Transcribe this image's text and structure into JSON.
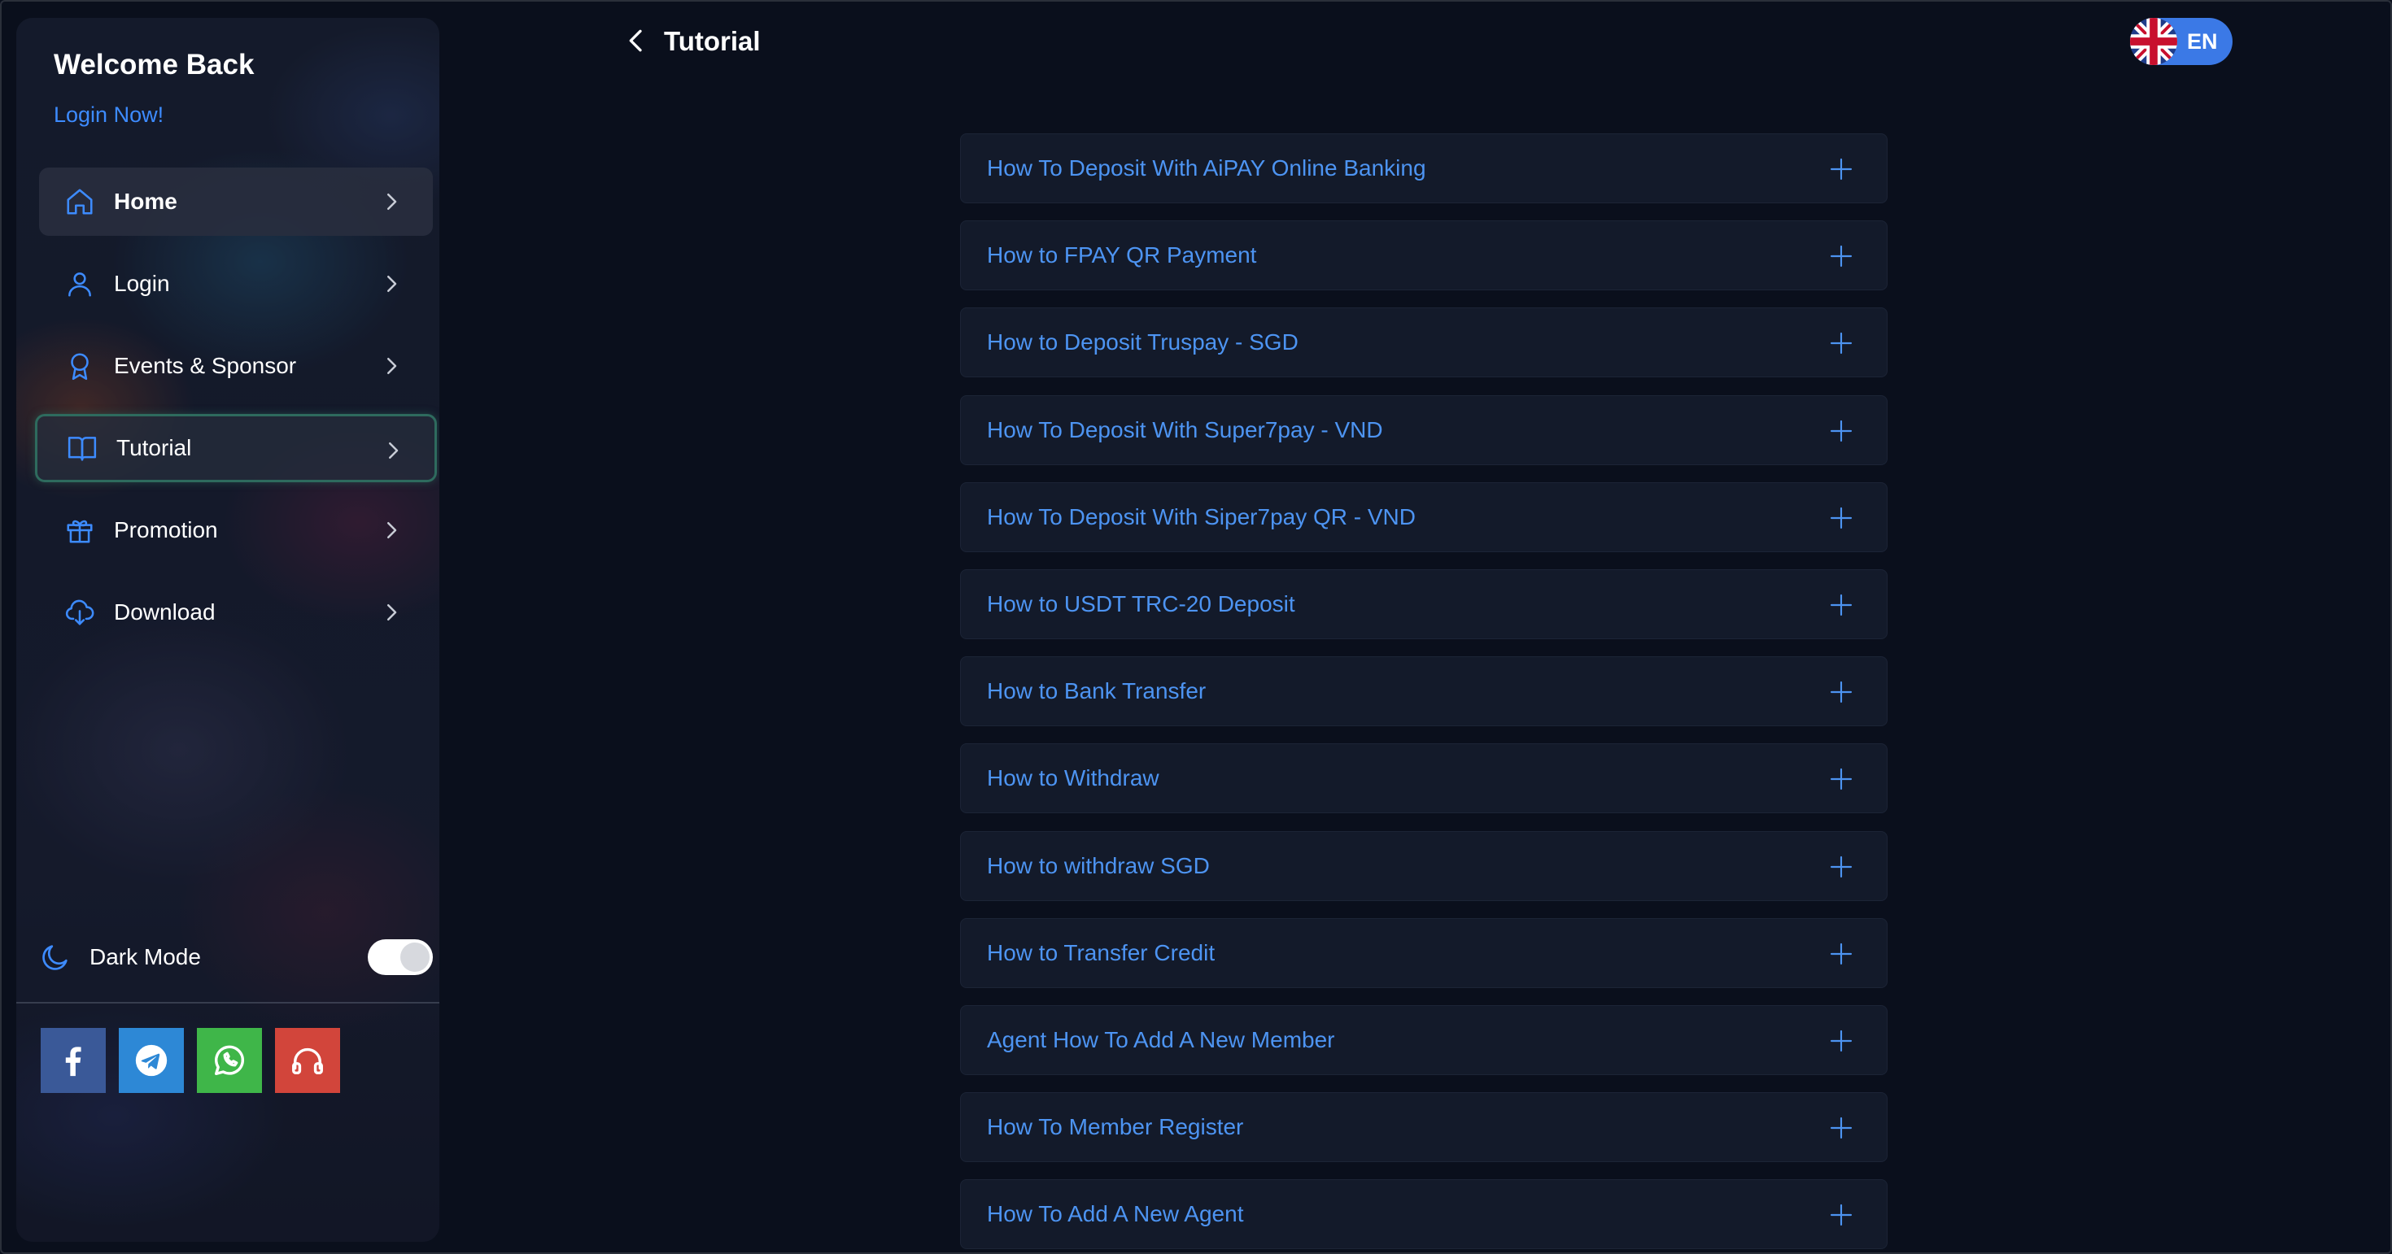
{
  "sidebar": {
    "welcome_title": "Welcome Back",
    "login_link": "Login Now!",
    "nav": [
      {
        "label": "Home",
        "icon": "home-icon"
      },
      {
        "label": "Login",
        "icon": "user-icon"
      },
      {
        "label": "Events & Sponsor",
        "icon": "award-icon"
      },
      {
        "label": "Tutorial",
        "icon": "book-icon",
        "active": true
      },
      {
        "label": "Promotion",
        "icon": "gift-icon"
      },
      {
        "label": "Download",
        "icon": "cloud-download-icon"
      }
    ],
    "dark_mode": {
      "label": "Dark Mode",
      "enabled": true
    },
    "socials": [
      "facebook-icon",
      "telegram-icon",
      "whatsapp-icon",
      "headset-icon"
    ]
  },
  "header": {
    "title": "Tutorial",
    "language": "EN"
  },
  "tutorials": [
    "How To Deposit With AiPAY Online Banking",
    "How to FPAY QR Payment",
    "How to Deposit Truspay - SGD",
    "How To Deposit With Super7pay - VND",
    "How To Deposit With Siper7pay QR - VND",
    "How to USDT TRC-20 Deposit",
    "How to Bank Transfer",
    "How to Withdraw",
    "How to withdraw SGD",
    "How to Transfer Credit",
    "Agent How To Add A New Member",
    "How To Member Register",
    "How To Add A New Agent"
  ],
  "colors": {
    "background": "#0a0f1c",
    "accent": "#3d8bff",
    "accordion_text": "#4d94f2",
    "active_border": "#2e6b5e"
  }
}
